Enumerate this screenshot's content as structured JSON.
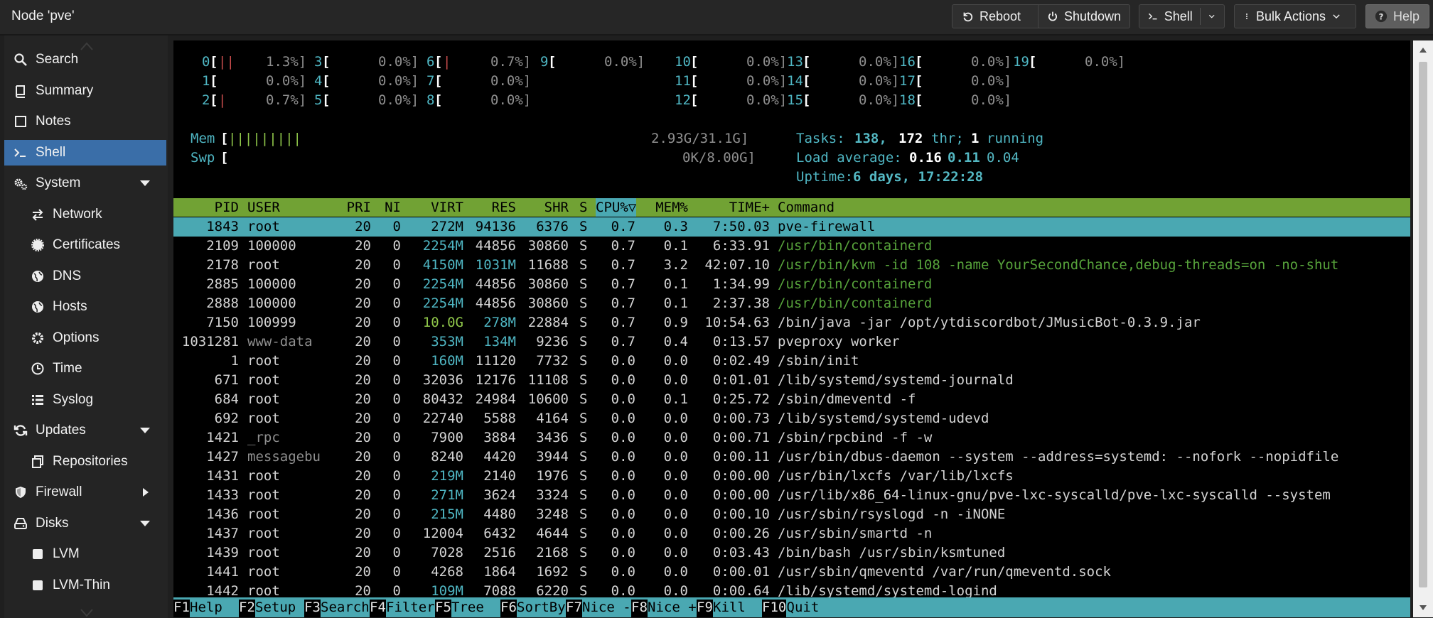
{
  "header": {
    "title": "Node 'pve'",
    "reboot": "Reboot",
    "shutdown": "Shutdown",
    "shell": "Shell",
    "bulk_actions": "Bulk Actions",
    "help": "Help"
  },
  "sidebar": {
    "items": [
      {
        "label": "Search",
        "icon": "search-icon",
        "indent": false,
        "selected": false,
        "arrow": ""
      },
      {
        "label": "Summary",
        "icon": "book-icon",
        "indent": false,
        "selected": false,
        "arrow": ""
      },
      {
        "label": "Notes",
        "icon": "note-icon",
        "indent": false,
        "selected": false,
        "arrow": ""
      },
      {
        "label": "Shell",
        "icon": "terminal-icon",
        "indent": false,
        "selected": true,
        "arrow": ""
      },
      {
        "label": "System",
        "icon": "gears-icon",
        "indent": false,
        "selected": false,
        "arrow": "down"
      },
      {
        "label": "Network",
        "icon": "exchange-icon",
        "indent": true,
        "selected": false,
        "arrow": ""
      },
      {
        "label": "Certificates",
        "icon": "certificate-icon",
        "indent": true,
        "selected": false,
        "arrow": ""
      },
      {
        "label": "DNS",
        "icon": "globe-icon",
        "indent": true,
        "selected": false,
        "arrow": ""
      },
      {
        "label": "Hosts",
        "icon": "globe-icon",
        "indent": true,
        "selected": false,
        "arrow": ""
      },
      {
        "label": "Options",
        "icon": "gear-icon",
        "indent": true,
        "selected": false,
        "arrow": ""
      },
      {
        "label": "Time",
        "icon": "clock-icon",
        "indent": true,
        "selected": false,
        "arrow": ""
      },
      {
        "label": "Syslog",
        "icon": "list-icon",
        "indent": true,
        "selected": false,
        "arrow": ""
      },
      {
        "label": "Updates",
        "icon": "refresh-icon",
        "indent": false,
        "selected": false,
        "arrow": "down"
      },
      {
        "label": "Repositories",
        "icon": "copy-icon",
        "indent": true,
        "selected": false,
        "arrow": ""
      },
      {
        "label": "Firewall",
        "icon": "shield-icon",
        "indent": false,
        "selected": false,
        "arrow": "right"
      },
      {
        "label": "Disks",
        "icon": "hdd-icon",
        "indent": false,
        "selected": false,
        "arrow": "down"
      },
      {
        "label": "LVM",
        "icon": "square-icon",
        "indent": true,
        "selected": false,
        "arrow": ""
      },
      {
        "label": "LVM-Thin",
        "icon": "square-icon",
        "indent": true,
        "selected": false,
        "arrow": ""
      }
    ]
  },
  "htop": {
    "cpus": [
      {
        "id": "0",
        "bar": "||",
        "pct": "1.3%]"
      },
      {
        "id": "1",
        "bar": "",
        "pct": "0.0%]"
      },
      {
        "id": "2",
        "bar": "|",
        "pct": "0.7%]"
      },
      {
        "id": "3",
        "bar": "",
        "pct": "0.0%]"
      },
      {
        "id": "4",
        "bar": "",
        "pct": "0.0%]"
      },
      {
        "id": "5",
        "bar": "",
        "pct": "0.0%]"
      },
      {
        "id": "6",
        "bar": "|",
        "pct": "0.7%]"
      },
      {
        "id": "7",
        "bar": "",
        "pct": "0.0%]"
      },
      {
        "id": "8",
        "bar": "",
        "pct": "0.0%]"
      },
      {
        "id": "9",
        "bar": "",
        "pct": "0.0%]"
      },
      {
        "id": "10",
        "bar": "",
        "pct": "0.0%]"
      },
      {
        "id": "11",
        "bar": "",
        "pct": "0.0%]"
      },
      {
        "id": "12",
        "bar": "",
        "pct": "0.0%]"
      },
      {
        "id": "13",
        "bar": "",
        "pct": "0.0%]"
      },
      {
        "id": "14",
        "bar": "",
        "pct": "0.0%]"
      },
      {
        "id": "15",
        "bar": "",
        "pct": "0.0%]"
      },
      {
        "id": "16",
        "bar": "",
        "pct": "0.0%]"
      },
      {
        "id": "17",
        "bar": "",
        "pct": "0.0%]"
      },
      {
        "id": "18",
        "bar": "",
        "pct": "0.0%]"
      },
      {
        "id": "19",
        "bar": "",
        "pct": "0.0%]"
      }
    ],
    "mem_label": "Mem",
    "mem_bar": "|||||||||",
    "mem_value": "2.93G/31.1G]",
    "swp_label": "Swp",
    "swp_value": "0K/8.00G]",
    "tasks_label": "Tasks:",
    "tasks_count": "138,",
    "threads_count": "172",
    "threads_label": "thr;",
    "running_count": "1",
    "running_label": "running",
    "load_label": "Load average:",
    "load_1": "0.16",
    "load_5": "0.11",
    "load_15": "0.04",
    "uptime_label": "Uptime:",
    "uptime_value": "6 days, 17:22:28",
    "columns": {
      "pid": "PID",
      "user": "USER",
      "pri": "PRI",
      "ni": "NI",
      "virt": "VIRT",
      "res": "RES",
      "shr": "SHR",
      "s": "S",
      "cpu": "CPU%▽",
      "mem": "MEM%",
      "time": "TIME+",
      "command": "Command"
    },
    "processes": [
      {
        "pid": "1843",
        "user": "root",
        "pri": "20",
        "ni": "0",
        "virt": "272M",
        "res": "94136",
        "shr": "6376",
        "s": "S",
        "cpu": "0.7",
        "mem": "0.3",
        "time": "7:50.03",
        "command": "pve-firewall",
        "hl": true,
        "thread": false
      },
      {
        "pid": "2109",
        "user": "100000",
        "pri": "20",
        "ni": "0",
        "virt": "2254M",
        "res": "44856",
        "shr": "30860",
        "s": "S",
        "cpu": "0.7",
        "mem": "0.1",
        "time": "6:33.91",
        "command": "/usr/bin/containerd",
        "hl": false,
        "thread": true
      },
      {
        "pid": "2178",
        "user": "root",
        "pri": "20",
        "ni": "0",
        "virt": "4150M",
        "res": "1031M",
        "shr": "11688",
        "s": "S",
        "cpu": "0.7",
        "mem": "3.2",
        "time": "42:07.10",
        "command": "/usr/bin/kvm -id 108 -name YourSecondChance,debug-threads=on -no-shut",
        "hl": false,
        "thread": true
      },
      {
        "pid": "2885",
        "user": "100000",
        "pri": "20",
        "ni": "0",
        "virt": "2254M",
        "res": "44856",
        "shr": "30860",
        "s": "S",
        "cpu": "0.7",
        "mem": "0.1",
        "time": "1:34.99",
        "command": "/usr/bin/containerd",
        "hl": false,
        "thread": true
      },
      {
        "pid": "2888",
        "user": "100000",
        "pri": "20",
        "ni": "0",
        "virt": "2254M",
        "res": "44856",
        "shr": "30860",
        "s": "S",
        "cpu": "0.7",
        "mem": "0.1",
        "time": "2:37.38",
        "command": "/usr/bin/containerd",
        "hl": false,
        "thread": true
      },
      {
        "pid": "7150",
        "user": "100999",
        "pri": "20",
        "ni": "0",
        "virt": "10.0G",
        "res": "278M",
        "shr": "22884",
        "s": "S",
        "cpu": "0.7",
        "mem": "0.9",
        "time": "10:54.63",
        "command": "/bin/java -jar /opt/ytdiscordbot/JMusicBot-0.3.9.jar",
        "hl": false,
        "thread": false
      },
      {
        "pid": "1031281",
        "user": "www-data",
        "pri": "20",
        "ni": "0",
        "virt": "353M",
        "res": "134M",
        "shr": "9236",
        "s": "S",
        "cpu": "0.7",
        "mem": "0.4",
        "time": "0:13.57",
        "command": "pveproxy worker",
        "hl": false,
        "thread": false
      },
      {
        "pid": "1",
        "user": "root",
        "pri": "20",
        "ni": "0",
        "virt": "160M",
        "res": "11120",
        "shr": "7732",
        "s": "S",
        "cpu": "0.0",
        "mem": "0.0",
        "time": "0:02.49",
        "command": "/sbin/init",
        "hl": false,
        "thread": false
      },
      {
        "pid": "671",
        "user": "root",
        "pri": "20",
        "ni": "0",
        "virt": "32036",
        "res": "12176",
        "shr": "11108",
        "s": "S",
        "cpu": "0.0",
        "mem": "0.0",
        "time": "0:01.01",
        "command": "/lib/systemd/systemd-journald",
        "hl": false,
        "thread": false
      },
      {
        "pid": "684",
        "user": "root",
        "pri": "20",
        "ni": "0",
        "virt": "80432",
        "res": "24984",
        "shr": "10600",
        "s": "S",
        "cpu": "0.0",
        "mem": "0.1",
        "time": "0:25.72",
        "command": "/sbin/dmeventd -f",
        "hl": false,
        "thread": false
      },
      {
        "pid": "692",
        "user": "root",
        "pri": "20",
        "ni": "0",
        "virt": "22740",
        "res": "5588",
        "shr": "4164",
        "s": "S",
        "cpu": "0.0",
        "mem": "0.0",
        "time": "0:00.73",
        "command": "/lib/systemd/systemd-udevd",
        "hl": false,
        "thread": false
      },
      {
        "pid": "1421",
        "user": "_rpc",
        "pri": "20",
        "ni": "0",
        "virt": "7900",
        "res": "3884",
        "shr": "3436",
        "s": "S",
        "cpu": "0.0",
        "mem": "0.0",
        "time": "0:00.71",
        "command": "/sbin/rpcbind -f -w",
        "hl": false,
        "thread": false
      },
      {
        "pid": "1427",
        "user": "messagebu",
        "pri": "20",
        "ni": "0",
        "virt": "8240",
        "res": "4420",
        "shr": "3944",
        "s": "S",
        "cpu": "0.0",
        "mem": "0.0",
        "time": "0:00.11",
        "command": "/usr/bin/dbus-daemon --system --address=systemd: --nofork --nopidfile",
        "hl": false,
        "thread": false
      },
      {
        "pid": "1431",
        "user": "root",
        "pri": "20",
        "ni": "0",
        "virt": "219M",
        "res": "2140",
        "shr": "1976",
        "s": "S",
        "cpu": "0.0",
        "mem": "0.0",
        "time": "0:00.00",
        "command": "/usr/bin/lxcfs /var/lib/lxcfs",
        "hl": false,
        "thread": false
      },
      {
        "pid": "1433",
        "user": "root",
        "pri": "20",
        "ni": "0",
        "virt": "271M",
        "res": "3624",
        "shr": "3324",
        "s": "S",
        "cpu": "0.0",
        "mem": "0.0",
        "time": "0:00.00",
        "command": "/usr/lib/x86_64-linux-gnu/pve-lxc-syscalld/pve-lxc-syscalld --system",
        "hl": false,
        "thread": false
      },
      {
        "pid": "1436",
        "user": "root",
        "pri": "20",
        "ni": "0",
        "virt": "215M",
        "res": "4480",
        "shr": "3248",
        "s": "S",
        "cpu": "0.0",
        "mem": "0.0",
        "time": "0:00.10",
        "command": "/usr/sbin/rsyslogd -n -iNONE",
        "hl": false,
        "thread": false
      },
      {
        "pid": "1437",
        "user": "root",
        "pri": "20",
        "ni": "0",
        "virt": "12004",
        "res": "6432",
        "shr": "4644",
        "s": "S",
        "cpu": "0.0",
        "mem": "0.0",
        "time": "0:00.26",
        "command": "/usr/sbin/smartd -n",
        "hl": false,
        "thread": false
      },
      {
        "pid": "1439",
        "user": "root",
        "pri": "20",
        "ni": "0",
        "virt": "7028",
        "res": "2516",
        "shr": "2168",
        "s": "S",
        "cpu": "0.0",
        "mem": "0.0",
        "time": "0:03.43",
        "command": "/bin/bash /usr/sbin/ksmtuned",
        "hl": false,
        "thread": false
      },
      {
        "pid": "1441",
        "user": "root",
        "pri": "20",
        "ni": "0",
        "virt": "4268",
        "res": "1864",
        "shr": "1692",
        "s": "S",
        "cpu": "0.0",
        "mem": "0.0",
        "time": "0:00.01",
        "command": "/usr/sbin/qmeventd /var/run/qmeventd.sock",
        "hl": false,
        "thread": false
      },
      {
        "pid": "1442",
        "user": "root",
        "pri": "20",
        "ni": "0",
        "virt": "109M",
        "res": "7088",
        "shr": "6220",
        "s": "S",
        "cpu": "0.0",
        "mem": "0.0",
        "time": "0:00.64",
        "command": "/lib/systemd/systemd-logind",
        "hl": false,
        "thread": false
      }
    ],
    "fkeys": [
      {
        "key": "F1",
        "label": "Help  "
      },
      {
        "key": "F2",
        "label": "Setup "
      },
      {
        "key": "F3",
        "label": "Search"
      },
      {
        "key": "F4",
        "label": "Filter"
      },
      {
        "key": "F5",
        "label": "Tree  "
      },
      {
        "key": "F6",
        "label": "SortBy"
      },
      {
        "key": "F7",
        "label": "Nice -"
      },
      {
        "key": "F8",
        "label": "Nice +"
      },
      {
        "key": "F9",
        "label": "Kill  "
      },
      {
        "key": "F10",
        "label": "Quit  "
      }
    ]
  }
}
